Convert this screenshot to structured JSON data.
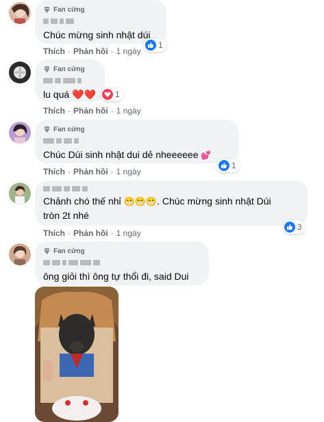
{
  "comments": [
    {
      "badge": "Fan cứng",
      "text": "Chúc mừng sinh nhật dúi",
      "actions": {
        "like": "Thích",
        "reply": "Phản hồi",
        "time": "1 ngày"
      },
      "reactions": {
        "count": "1"
      }
    },
    {
      "badge": "Fan cứng",
      "text": "lu quá",
      "actions": {
        "like": "Thích",
        "reply": "Phản hồi",
        "time": "1 ngày"
      },
      "reactions": {
        "count": "1"
      }
    },
    {
      "badge": "Fan cứng",
      "text": "Chúc Dúi sinh nhật dui dẻ nheeeeee",
      "actions": {
        "like": "Thích",
        "reply": "Phản hồi",
        "time": "1 ngày"
      },
      "reactions": {
        "count": "1"
      }
    },
    {
      "text_line1": "Chảnh chó thế nhỉ",
      "text_line1b": ". Chúc mừng sinh nhật Dúi",
      "text_line2": "tròn 2t nhé",
      "actions": {
        "like": "Thích",
        "reply": "Phản hồi",
        "time": "1 ngày"
      },
      "reactions": {
        "count": "3"
      }
    },
    {
      "badge": "Fan cứng",
      "text": "ông giỏi thì ông tự thổi đi, said Dui"
    }
  ],
  "colors": {
    "bubble": "#f0f2f5",
    "like_blue": "#1877f2",
    "love_red": "#f33e58",
    "meta_gray": "#65676b"
  },
  "icons": [
    "diamond-icon",
    "like-reaction-icon",
    "love-reaction-icon",
    "heart-emoji",
    "grinning-emoji"
  ]
}
